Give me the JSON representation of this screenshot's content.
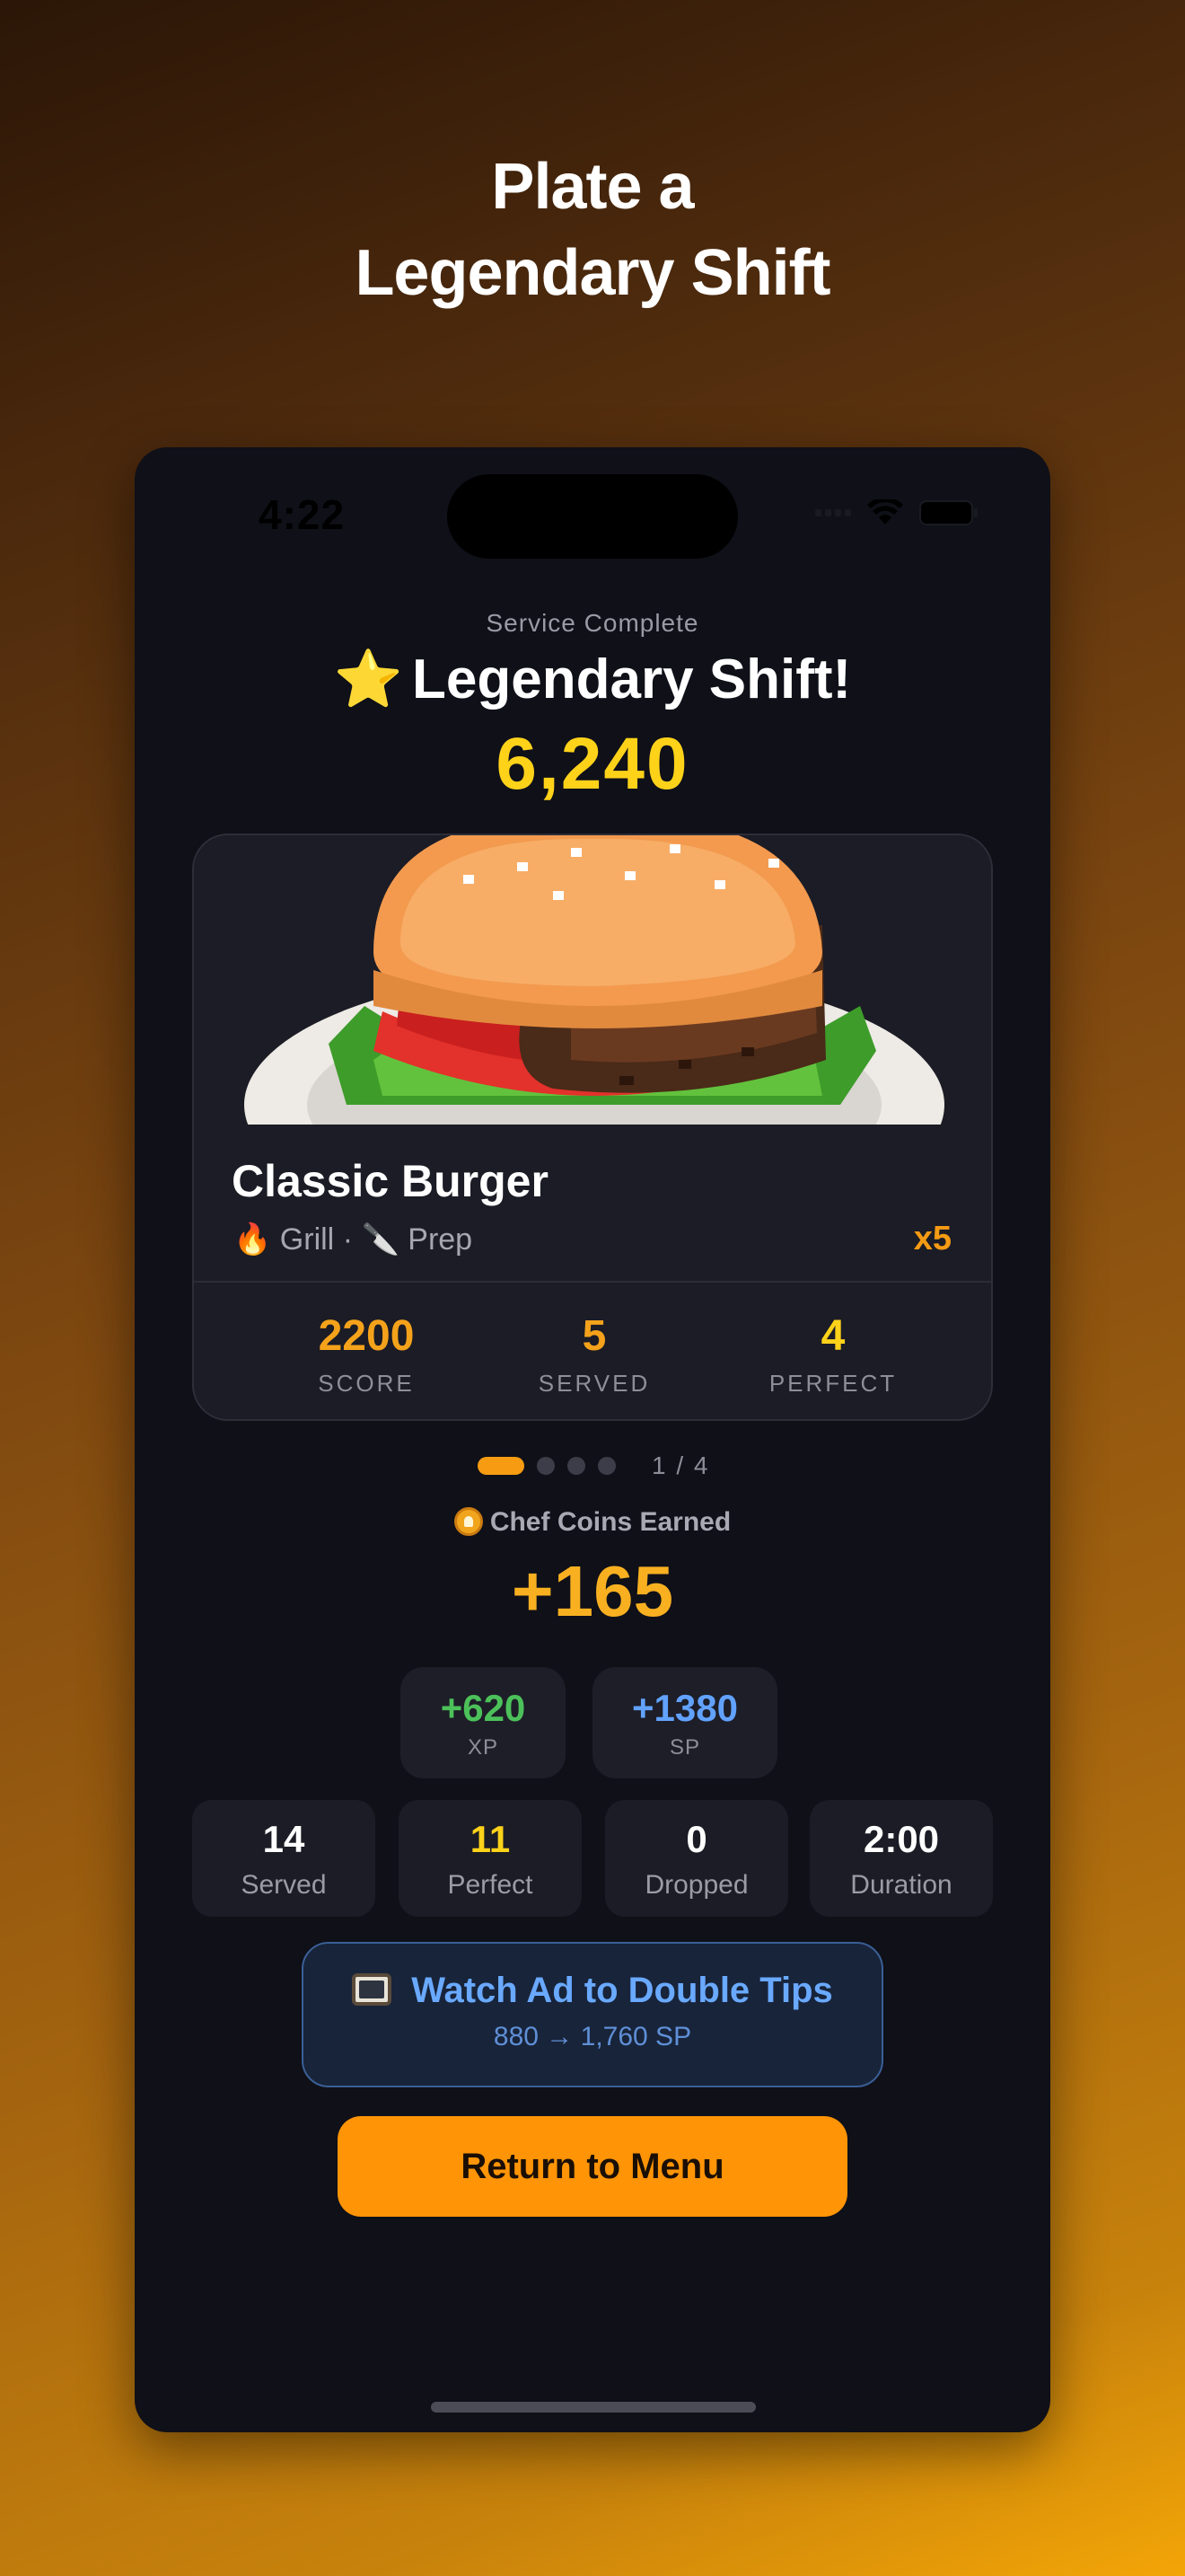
{
  "headline": {
    "line1": "Plate a",
    "line2": "Legendary Shift"
  },
  "status_bar": {
    "time": "4:22"
  },
  "results": {
    "subtitle": "Service Complete",
    "title_emoji": "⭐",
    "title": "Legendary Shift!",
    "score": "6,240"
  },
  "dish_card": {
    "name": "Classic Burger",
    "station1_emoji": "🔥",
    "station1": "Grill",
    "separator": "·",
    "station2_emoji": "🔪",
    "station2": "Prep",
    "multiplier": "x5",
    "stats": [
      {
        "value": "2200",
        "label": "SCORE",
        "color": "#f5a21b"
      },
      {
        "value": "5",
        "label": "SERVED",
        "color": "#f5a21b"
      },
      {
        "value": "4",
        "label": "PERFECT",
        "color": "#ffd21a"
      }
    ]
  },
  "pager": {
    "text": "1 / 4",
    "total": 4,
    "active_index": 0
  },
  "coins": {
    "label": "Chef Coins Earned",
    "value": "+165"
  },
  "rewards": {
    "xp": {
      "value": "+620",
      "label": "XP",
      "color": "#4cc15a"
    },
    "sp": {
      "value": "+1380",
      "label": "SP",
      "color": "#62a2ff"
    }
  },
  "summary": [
    {
      "value": "14",
      "label": "Served",
      "color": "#ffffff"
    },
    {
      "value": "11",
      "label": "Perfect",
      "color": "#ffd21a"
    },
    {
      "value": "0",
      "label": "Dropped",
      "color": "#ffffff"
    },
    {
      "value": "2:00",
      "label": "Duration",
      "color": "#ffffff"
    }
  ],
  "ad_button": {
    "label": "Watch Ad to Double Tips",
    "subtext": "880 → 1,760 SP",
    "icon": "tv-icon"
  },
  "menu_button": {
    "label": "Return to Menu"
  },
  "colors": {
    "accent": "#ff9406",
    "gold": "#ffd21a",
    "panel": "#0f1018"
  }
}
